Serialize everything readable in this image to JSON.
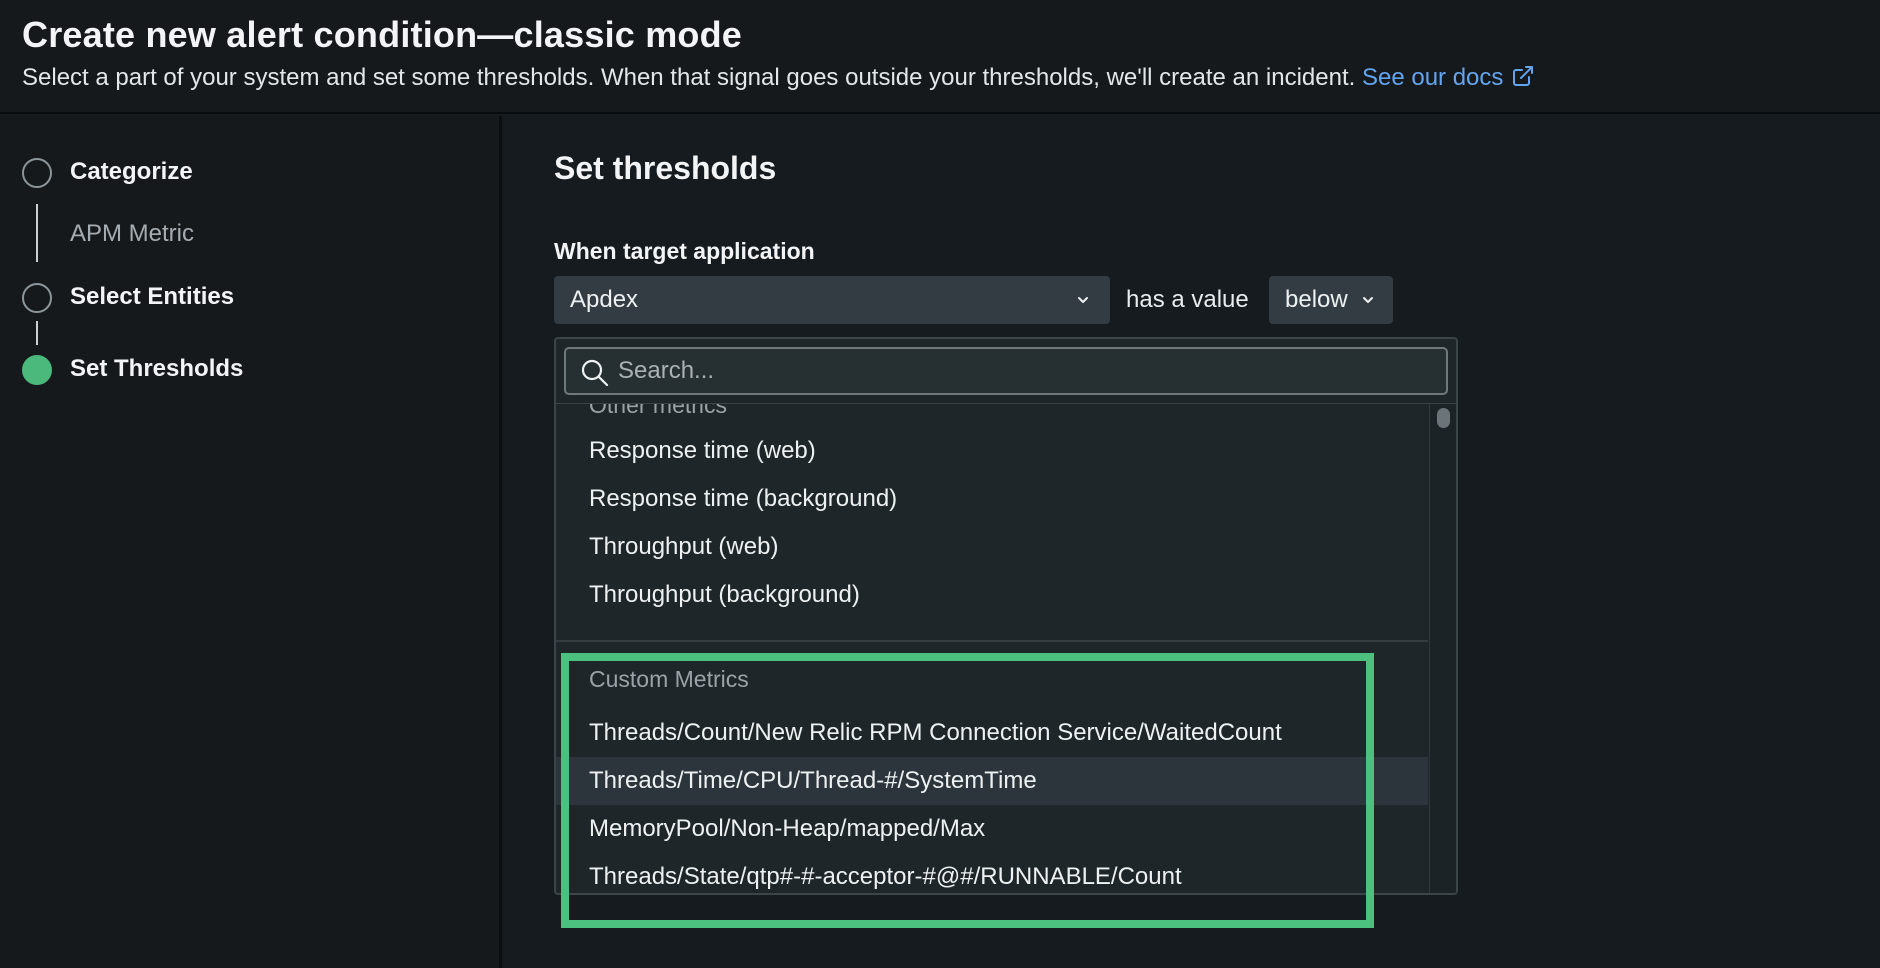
{
  "header": {
    "title": "Create new alert condition—classic mode",
    "subtitle": "Select a part of your system and set some thresholds. When that signal goes outside your thresholds, we'll create an incident.",
    "docs_link": "See our docs"
  },
  "sidebar": {
    "steps": [
      {
        "label": "Categorize",
        "sub": "APM Metric",
        "state": "incomplete"
      },
      {
        "label": "Select Entities",
        "state": "incomplete"
      },
      {
        "label": "Set Thresholds",
        "state": "current"
      }
    ]
  },
  "main": {
    "section_title": "Set thresholds",
    "target_label": "When target application",
    "metric_selected": "Apdex",
    "has_value_text": "has a value",
    "operator_selected": "below",
    "dropdown": {
      "search_placeholder": "Search...",
      "other_group": "Other metrics",
      "other_items": [
        "Response time (web)",
        "Response time (background)",
        "Throughput (web)",
        "Throughput (background)"
      ],
      "custom_group": "Custom Metrics",
      "custom_items": [
        "Threads/Count/New Relic RPM Connection Service/WaitedCount",
        "Threads/Time/CPU/Thread-#/SystemTime",
        "MemoryPool/Non-Heap/mapped/Max",
        "Threads/State/qtp#-#-acceptor-#@#/RUNNABLE/Count"
      ]
    }
  },
  "colors": {
    "accent_green": "#4cc07e",
    "link_blue": "#62a4ee",
    "background": "#141a1e"
  },
  "icons": [
    "external-link-icon",
    "chevron-down-icon",
    "search-icon"
  ]
}
